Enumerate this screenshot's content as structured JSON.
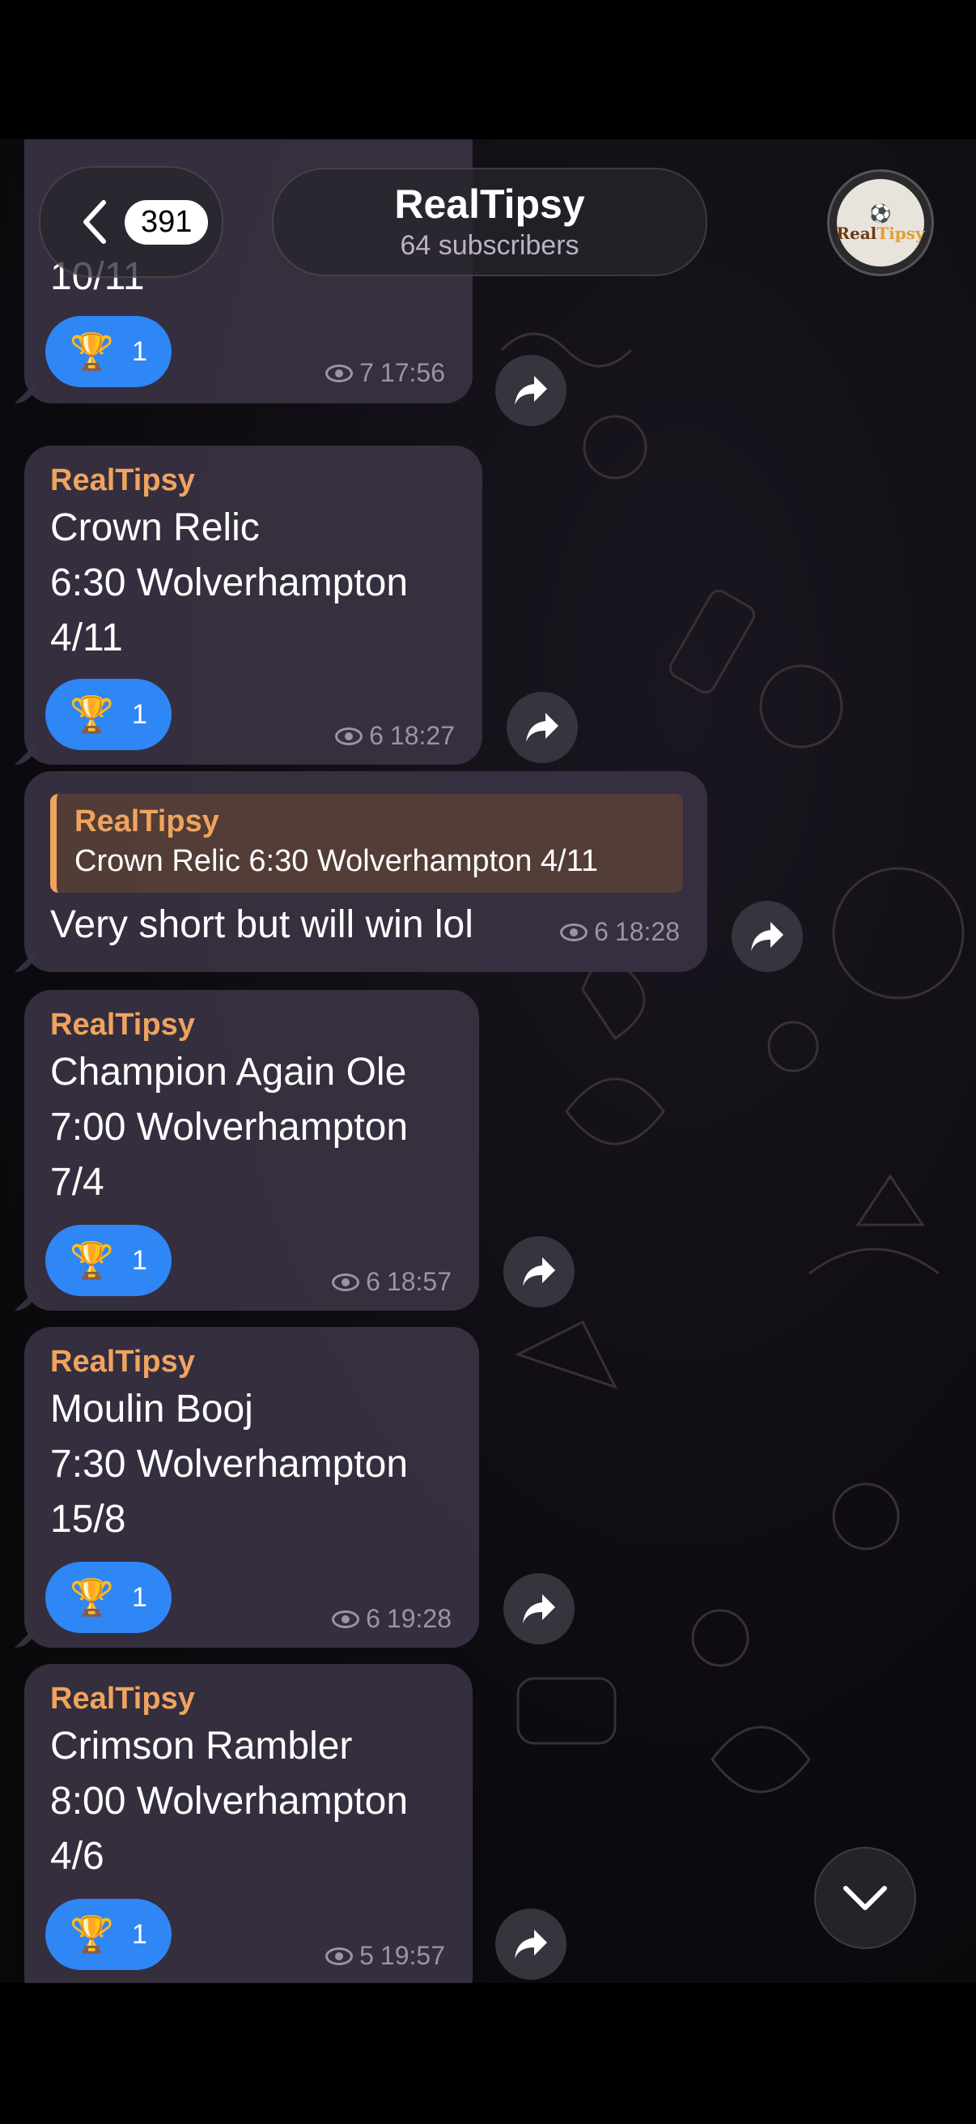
{
  "header": {
    "back_count": "391",
    "title": "RealTipsy",
    "subtitle": "64 subscribers",
    "avatar_text_top": "Real",
    "avatar_text_brand": "Tipsy"
  },
  "messages": [
    {
      "partial_text": "10/11",
      "reaction_count": "1",
      "views": "7",
      "time": "17:56"
    },
    {
      "sender": "RealTipsy",
      "text": "Crown Relic\n6:30 Wolverhampton\n4/11",
      "reaction_count": "1",
      "views": "6",
      "time": "18:27"
    },
    {
      "reply_sender": "RealTipsy",
      "reply_text": "Crown Relic 6:30 Wolverhampton 4/11",
      "text": "Very short but will win lol",
      "views": "6",
      "time": "18:28"
    },
    {
      "sender": "RealTipsy",
      "text": "Champion Again Ole\n7:00 Wolverhampton\n7/4",
      "reaction_count": "1",
      "views": "6",
      "time": "18:57"
    },
    {
      "sender": "RealTipsy",
      "text": "Moulin Booj\n7:30 Wolverhampton\n15/8",
      "reaction_count": "1",
      "views": "6",
      "time": "19:28"
    },
    {
      "sender": "RealTipsy",
      "text": "Crimson Rambler\n8:00 Wolverhampton\n4/6",
      "reaction_count": "1",
      "views": "5",
      "time": "19:57"
    }
  ],
  "icons": {
    "reaction": "trophy-icon",
    "views": "eye-icon",
    "share": "share-arrow-icon",
    "back": "chevron-left-icon",
    "scroll": "chevron-down-icon"
  },
  "colors": {
    "accent": "#f0a35e",
    "reaction": "#2f86f5",
    "bubble": "#383242"
  }
}
